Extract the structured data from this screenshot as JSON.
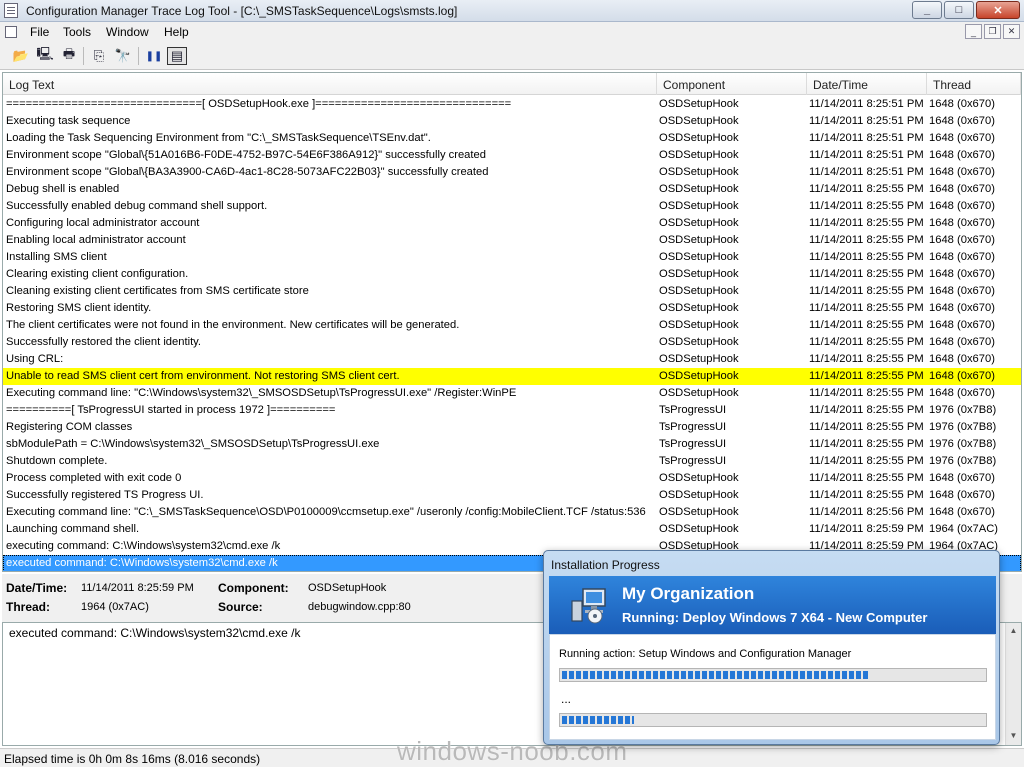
{
  "window": {
    "title": "Configuration Manager Trace Log Tool - [C:\\_SMSTaskSequence\\Logs\\smsts.log]",
    "minimize": "_",
    "maximize": "□",
    "close": "✕"
  },
  "menu": {
    "file": "File",
    "tools": "Tools",
    "window": "Window",
    "help": "Help"
  },
  "mdi": {
    "minimize": "_",
    "restore": "❐",
    "close": "✕"
  },
  "toolbar": {
    "open": "📂",
    "open_server": "🖳",
    "print": "🖶",
    "copy": "⎘",
    "find": "🔭",
    "pause": "❚❚",
    "highlight": "▤"
  },
  "columns": {
    "log_text": "Log Text",
    "component": "Component",
    "datetime": "Date/Time",
    "thread": "Thread"
  },
  "log_rows": [
    {
      "text": "==============================[ OSDSetupHook.exe ]==============================",
      "component": "OSDSetupHook",
      "datetime": "11/14/2011 8:25:51 PM",
      "thread": "1648 (0x670)"
    },
    {
      "text": "Executing task sequence",
      "component": "OSDSetupHook",
      "datetime": "11/14/2011 8:25:51 PM",
      "thread": "1648 (0x670)"
    },
    {
      "text": "Loading the Task Sequencing Environment from \"C:\\_SMSTaskSequence\\TSEnv.dat\".",
      "component": "OSDSetupHook",
      "datetime": "11/14/2011 8:25:51 PM",
      "thread": "1648 (0x670)"
    },
    {
      "text": "Environment scope \"Global\\{51A016B6-F0DE-4752-B97C-54E6F386A912}\" successfully created",
      "component": "OSDSetupHook",
      "datetime": "11/14/2011 8:25:51 PM",
      "thread": "1648 (0x670)"
    },
    {
      "text": "Environment scope \"Global\\{BA3A3900-CA6D-4ac1-8C28-5073AFC22B03}\" successfully created",
      "component": "OSDSetupHook",
      "datetime": "11/14/2011 8:25:51 PM",
      "thread": "1648 (0x670)"
    },
    {
      "text": "Debug shell is enabled",
      "component": "OSDSetupHook",
      "datetime": "11/14/2011 8:25:55 PM",
      "thread": "1648 (0x670)"
    },
    {
      "text": "Successfully enabled debug command shell support.",
      "component": "OSDSetupHook",
      "datetime": "11/14/2011 8:25:55 PM",
      "thread": "1648 (0x670)"
    },
    {
      "text": "Configuring local administrator account",
      "component": "OSDSetupHook",
      "datetime": "11/14/2011 8:25:55 PM",
      "thread": "1648 (0x670)"
    },
    {
      "text": "Enabling local administrator account",
      "component": "OSDSetupHook",
      "datetime": "11/14/2011 8:25:55 PM",
      "thread": "1648 (0x670)"
    },
    {
      "text": "Installing SMS client",
      "component": "OSDSetupHook",
      "datetime": "11/14/2011 8:25:55 PM",
      "thread": "1648 (0x670)"
    },
    {
      "text": "Clearing existing client configuration.",
      "component": "OSDSetupHook",
      "datetime": "11/14/2011 8:25:55 PM",
      "thread": "1648 (0x670)"
    },
    {
      "text": "Cleaning existing client certificates from SMS certificate store",
      "component": "OSDSetupHook",
      "datetime": "11/14/2011 8:25:55 PM",
      "thread": "1648 (0x670)"
    },
    {
      "text": "Restoring SMS client identity.",
      "component": "OSDSetupHook",
      "datetime": "11/14/2011 8:25:55 PM",
      "thread": "1648 (0x670)"
    },
    {
      "text": "The client certificates were not found in the environment. New certificates will be generated.",
      "component": "OSDSetupHook",
      "datetime": "11/14/2011 8:25:55 PM",
      "thread": "1648 (0x670)"
    },
    {
      "text": "Successfully restored the client identity.",
      "component": "OSDSetupHook",
      "datetime": "11/14/2011 8:25:55 PM",
      "thread": "1648 (0x670)"
    },
    {
      "text": "Using CRL:",
      "component": "OSDSetupHook",
      "datetime": "11/14/2011 8:25:55 PM",
      "thread": "1648 (0x670)"
    },
    {
      "text": "Unable to read SMS client cert from environment. Not restoring SMS client cert.",
      "component": "OSDSetupHook",
      "datetime": "11/14/2011 8:25:55 PM",
      "thread": "1648 (0x670)",
      "status": "warn"
    },
    {
      "text": "Executing command line: \"C:\\Windows\\system32\\_SMSOSDSetup\\TsProgressUI.exe\" /Register:WinPE",
      "component": "OSDSetupHook",
      "datetime": "11/14/2011 8:25:55 PM",
      "thread": "1648 (0x670)"
    },
    {
      "text": "==========[ TsProgressUI started in process 1972 ]==========",
      "component": "TsProgressUI",
      "datetime": "11/14/2011 8:25:55 PM",
      "thread": "1976 (0x7B8)"
    },
    {
      "text": "Registering COM classes",
      "component": "TsProgressUI",
      "datetime": "11/14/2011 8:25:55 PM",
      "thread": "1976 (0x7B8)"
    },
    {
      "text": "sbModulePath = C:\\Windows\\system32\\_SMSOSDSetup\\TsProgressUI.exe",
      "component": "TsProgressUI",
      "datetime": "11/14/2011 8:25:55 PM",
      "thread": "1976 (0x7B8)"
    },
    {
      "text": "Shutdown complete.",
      "component": "TsProgressUI",
      "datetime": "11/14/2011 8:25:55 PM",
      "thread": "1976 (0x7B8)"
    },
    {
      "text": "Process completed with exit code 0",
      "component": "OSDSetupHook",
      "datetime": "11/14/2011 8:25:55 PM",
      "thread": "1648 (0x670)"
    },
    {
      "text": "Successfully registered TS Progress UI.",
      "component": "OSDSetupHook",
      "datetime": "11/14/2011 8:25:55 PM",
      "thread": "1648 (0x670)"
    },
    {
      "text": "Executing command line: \"C:\\_SMSTaskSequence\\OSD\\P0100009\\ccmsetup.exe\" /useronly /config:MobileClient.TCF /status:536",
      "component": "OSDSetupHook",
      "datetime": "11/14/2011 8:25:56 PM",
      "thread": "1648 (0x670)"
    },
    {
      "text": "Launching command shell.",
      "component": "OSDSetupHook",
      "datetime": "11/14/2011 8:25:59 PM",
      "thread": "1964 (0x7AC)"
    },
    {
      "text": "executing command: C:\\Windows\\system32\\cmd.exe /k",
      "component": "OSDSetupHook",
      "datetime": "11/14/2011 8:25:59 PM",
      "thread": "1964 (0x7AC)"
    },
    {
      "text": "executed command: C:\\Windows\\system32\\cmd.exe /k",
      "component": "OSDSetupHook",
      "datetime": "11/14/2011 8:25:59 PM",
      "thread": "1964 (0x7AC)",
      "status": "selected"
    }
  ],
  "detail": {
    "datetime_label": "Date/Time:",
    "datetime_value": "11/14/2011 8:25:59 PM",
    "component_label": "Component:",
    "component_value": "OSDSetupHook",
    "thread_label": "Thread:",
    "thread_value": "1964 (0x7AC)",
    "source_label": "Source:",
    "source_value": "debugwindow.cpp:80",
    "message": "executed command: C:\\Windows\\system32\\cmd.exe /k"
  },
  "status_bar": {
    "text": "Elapsed time is 0h 0m 8s 16ms (8.016 seconds)"
  },
  "watermark": "windows-noob.com",
  "progress_dialog": {
    "title": "Installation Progress",
    "organization": "My Organization",
    "running": "Running: Deploy Windows 7 X64 - New Computer",
    "action": "Running action: Setup Windows and Configuration Manager",
    "sub_text": "...",
    "overall_progress": 0.73,
    "action_progress": 0.17
  }
}
